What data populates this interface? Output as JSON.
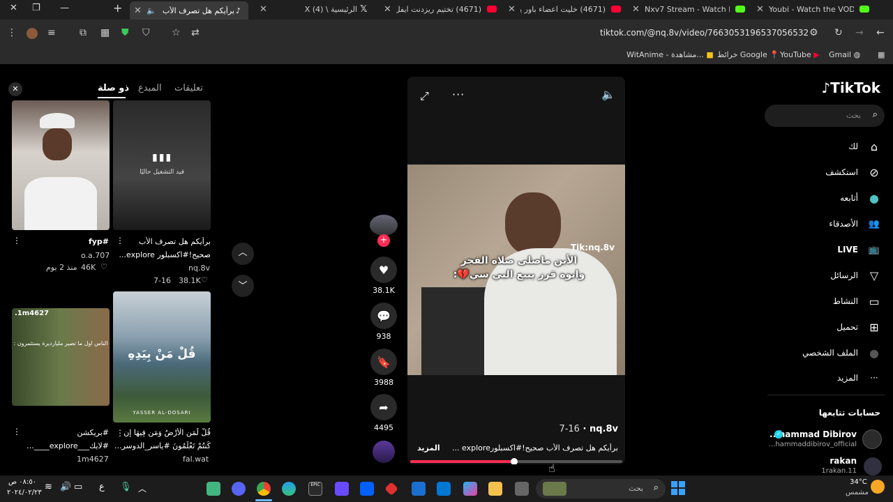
{
  "tabs": [
    {
      "label": "Youbi - Watch the VOD on",
      "icon_color": "#53fc18"
    },
    {
      "label": "Nxv7 Stream - Watch Live",
      "icon_color": "#53fc18"
    },
    {
      "label": "(4671) خليت اعضاء باور يجر",
      "icon_color": "#ff0033"
    },
    {
      "label": "(4671) تختيم ريزدنت ايفل 7",
      "icon_color": "#ff0033"
    },
    {
      "label": "الرئيسية \\ X (4)",
      "icon_color": "#ffffff"
    },
    {
      "label": "برأيكم هل تصرف الأب ص",
      "icon_color": "#ffffff"
    }
  ],
  "window_controls": {
    "close": "✕",
    "restore": "❐",
    "minimize": "—",
    "new_tab": "+"
  },
  "address_bar": {
    "url": "tiktok.com/@nq.8v/video/7663053196537056532"
  },
  "bookmarks": [
    {
      "label": "Gmail"
    },
    {
      "label": "YouTube"
    },
    {
      "label": "خرائط Google"
    },
    {
      "label": "WitAnime - مشاهدة..."
    }
  ],
  "right_nav": {
    "brand": "TikTok",
    "search_placeholder": "بحث",
    "items": [
      {
        "label": "لك",
        "icon": "home-icon",
        "glyph": "⌂"
      },
      {
        "label": "استكشف",
        "icon": "compass-icon",
        "glyph": "⊘"
      },
      {
        "label": "أتابعه",
        "icon": "avatar-icon",
        "glyph": "●"
      },
      {
        "label": "الأصدقاء",
        "icon": "friends-icon",
        "glyph": "👥"
      },
      {
        "label": "LIVE",
        "icon": "live-icon",
        "glyph": "📺"
      },
      {
        "label": "الرسائل",
        "icon": "send-icon",
        "glyph": "▽"
      },
      {
        "label": "النشاط",
        "icon": "activity-icon",
        "glyph": "▭"
      },
      {
        "label": "تحميل",
        "icon": "upload-icon",
        "glyph": "⊞"
      },
      {
        "label": "الملف الشخصي",
        "icon": "profile-icon",
        "glyph": "●"
      },
      {
        "label": "المزيد",
        "icon": "more-icon",
        "glyph": "···"
      }
    ],
    "following_title": "حسابات تتابعها",
    "following": [
      {
        "name": "...hammad Dibirov",
        "handle": "...hammaddibirov_official"
      },
      {
        "name": "rakan",
        "handle": "1rakan.11"
      }
    ]
  },
  "left_panel": {
    "tabs": [
      "تعليقات",
      "المبدع",
      "ذو صلة"
    ],
    "active_tab": "ذو صلة",
    "close": "✕",
    "items": [
      {
        "caption": "برأيكم هل تصرف الأب",
        "caption2": "صحيح!#اكسبلور explore...",
        "author": "nq.8v",
        "likes": "38.1K",
        "date": "7-16",
        "overlay": "قيد التشغيل حاليًا"
      },
      {
        "caption": "#fyp",
        "caption2": "",
        "author": "o.a.707",
        "likes": "46K",
        "date": "منذ 2 يوم",
        "overlay": ""
      },
      {
        "caption": "قُلْ لِّمَنِ الْأَرْضُ وَمَن فِيهَا إِن",
        "caption2": "كُنتُمْ تَعْلَمُونَ #ياسر_الدوسر...",
        "author": "fal.wat",
        "likes": "",
        "date": "",
        "overlay": "قُلْ مَنْ بِيَدِهِ",
        "overlay2": "YASSER AL-DOSARI"
      },
      {
        "caption": "#بريكشن",
        "caption2": "#لايك___explore____...",
        "author": "1m4627",
        "likes": "",
        "date": "",
        "overlay": "الناس اول ما تصير مليارديرة يستثمرون :",
        "overlay2": ".1m4627"
      }
    ]
  },
  "video": {
    "overlay_line1": "الأبن ماصلى صلاه الفجر",
    "overlay_line2": "وابوه قرر يبيع البي سي💔:",
    "watermark": "Tik:nq.8v",
    "author": "nq.8v",
    "date": "7-16",
    "description": "برأيكم هل تصرف الأب صحيح!#اكسبلورexplore ...",
    "more_label": "المزيد",
    "progress": 0.49
  },
  "actions": {
    "likes": "38.1K",
    "comments": "938",
    "saves": "3988",
    "shares": "4495"
  },
  "taskbar": {
    "search_placeholder": "بحث",
    "time": "٠٨:٥٠ ص",
    "date": "٢٠٢٤/٠٢/٢٣",
    "weather_temp": "34°C",
    "weather_desc": "مشمس",
    "lang": "ع"
  },
  "colors": {
    "tiktok_pink": "#fe2c55",
    "youtube_red": "#ff0033",
    "kick_green": "#53fc18"
  }
}
